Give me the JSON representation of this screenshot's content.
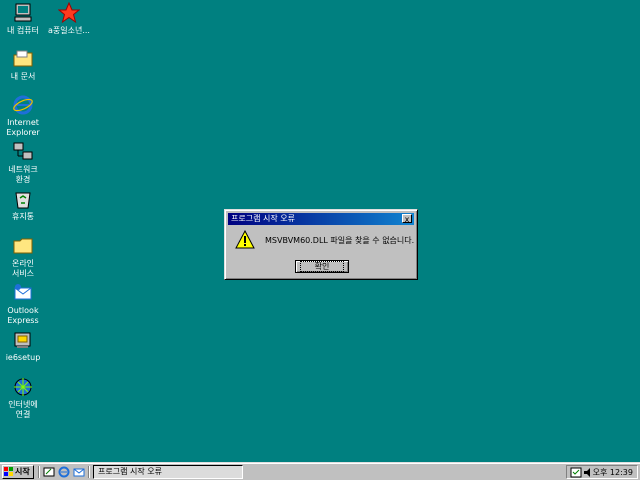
{
  "desktop": {
    "icons": [
      {
        "label": "내 컴퓨터"
      },
      {
        "label": "a풍일소년..."
      },
      {
        "label": "내 문서"
      },
      {
        "label": "Internet\nExplorer"
      },
      {
        "label": "네트워크\n환경"
      },
      {
        "label": "휴지통"
      },
      {
        "label": "온라인\n서비스"
      },
      {
        "label": "Outlook\nExpress"
      },
      {
        "label": "ie6setup"
      },
      {
        "label": "인터넷에\n연결"
      }
    ]
  },
  "dialog": {
    "title": "프로그램 시작 오류",
    "close_label": "x",
    "message": "MSVBVM60.DLL 파일을 찾을 수 없습니다.",
    "ok_label": "확인"
  },
  "taskbar": {
    "start_label": "시작",
    "task_label": "프로그램 시작 오류",
    "clock": "오후 12:39"
  },
  "colors": {
    "desktop": "#008080",
    "titlebar": "#000080"
  }
}
